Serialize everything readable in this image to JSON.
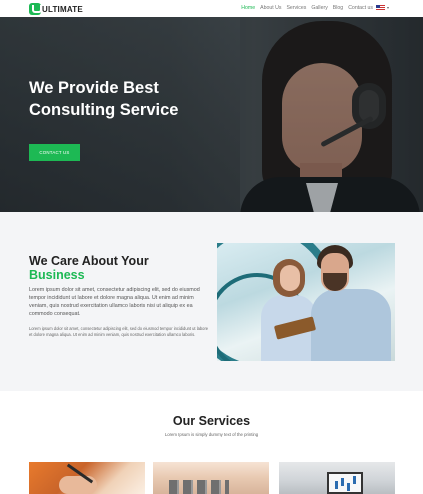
{
  "brand": {
    "logo_text": "ULTIMATE",
    "accent": "#1db954"
  },
  "nav": {
    "items": [
      "Home",
      "About Us",
      "Services",
      "Gallery",
      "Blog",
      "Contact us"
    ],
    "active": "Home",
    "language_icon": "us-flag-icon"
  },
  "hero": {
    "title_line1": "We Provide Best",
    "title_line2": "Consulting Service",
    "button_label": "CONTACT US"
  },
  "care": {
    "title_line1": "We Care About Your",
    "title_line2": "Business",
    "paragraph1": "Lorem ipsum dolor sit amet, consectetur adipiscing elit, sed do eiusmod tempor incididunt ut labore et dolore magna aliqua. Ut enim ad minim veniam, quis nostrud exercitation ullamco laboris nisi ut aliquip ex ea commodo consequat.",
    "paragraph2": "Lorem ipsum dolor sit amet, consectetur adipiscing elit, sed do eiusmod tempor incididunt ut labore et dolore magna aliqua. Ut enim ad minim veniam, quis nostrud exercitation ullamco laboris."
  },
  "services": {
    "title": "Our Services",
    "subtitle": "Lorem Ipsum is simply dummy text of the printing"
  }
}
